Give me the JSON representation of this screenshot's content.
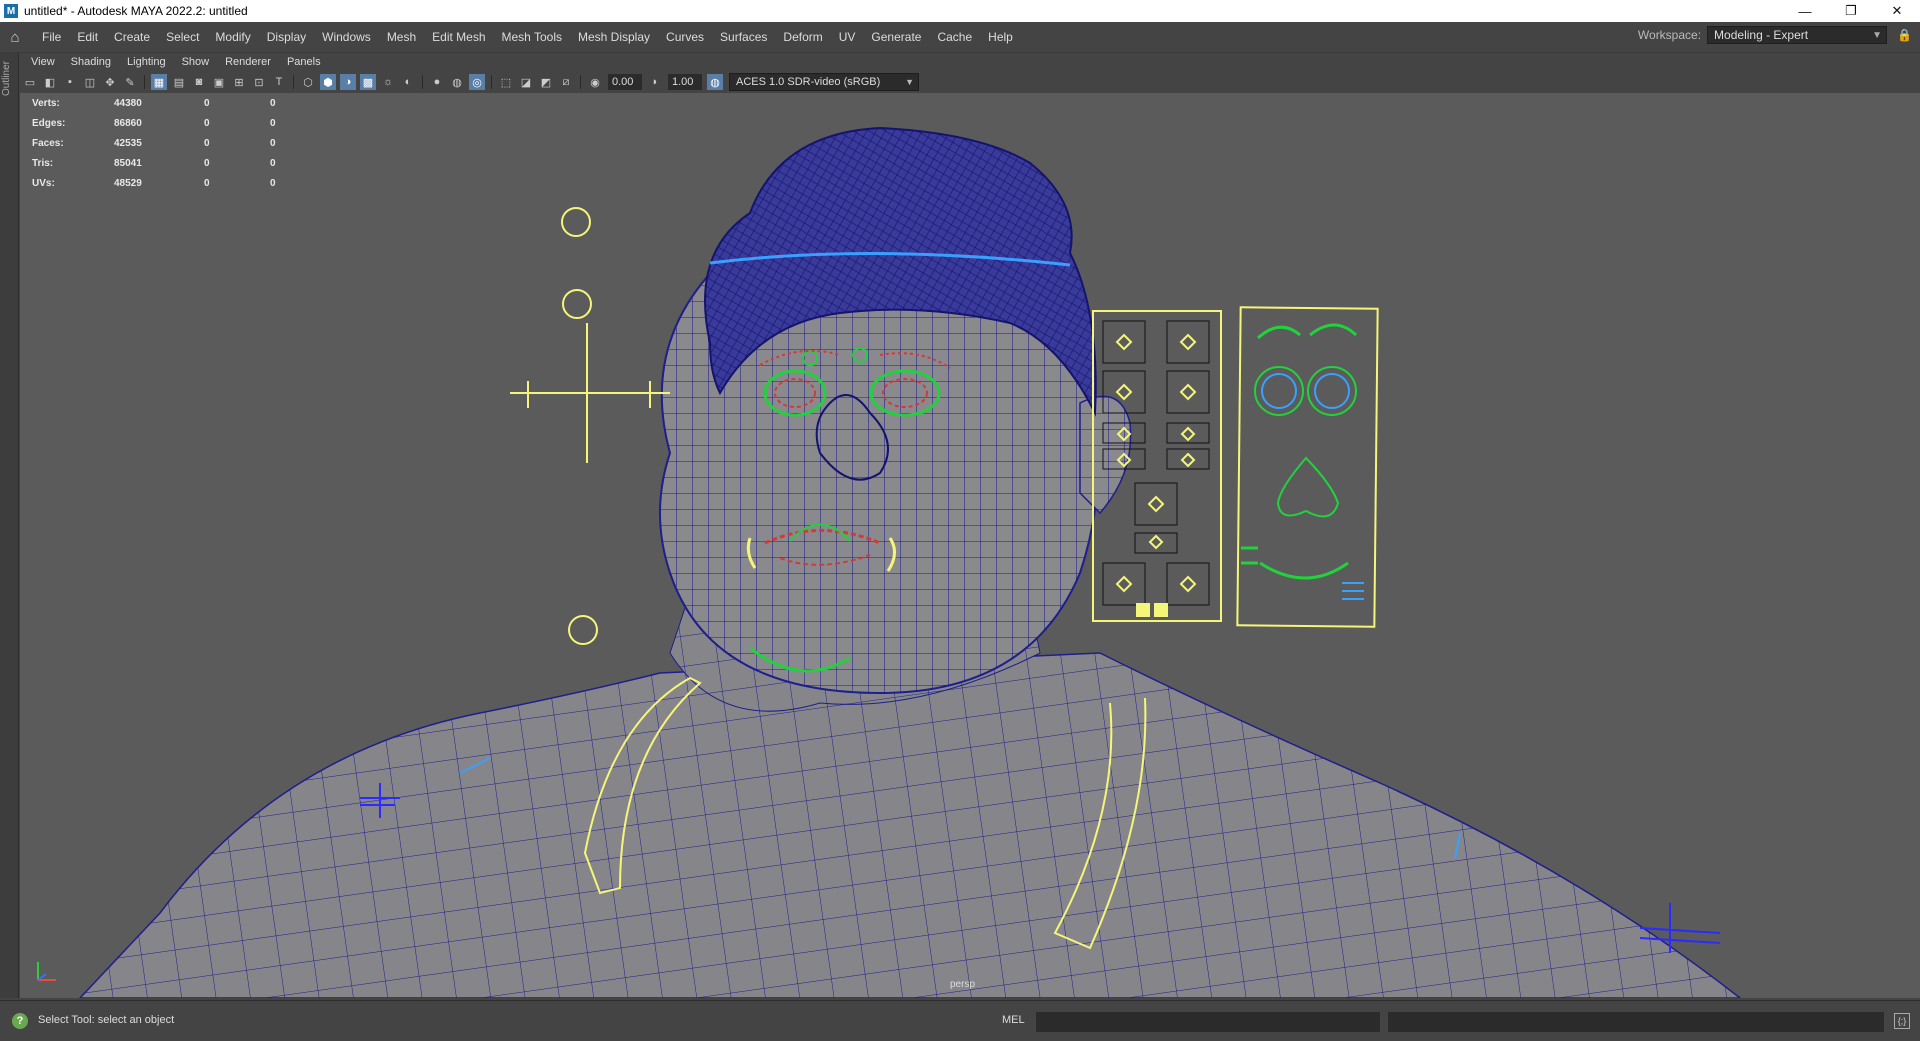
{
  "window": {
    "title": "untitled* - Autodesk MAYA 2022.2: untitled",
    "app_icon": "M",
    "controls": {
      "minimize": "—",
      "restore": "❐",
      "close": "✕"
    }
  },
  "menubar": {
    "home_icon": "⌂",
    "items": [
      "File",
      "Edit",
      "Create",
      "Select",
      "Modify",
      "Display",
      "Windows",
      "Mesh",
      "Edit Mesh",
      "Mesh Tools",
      "Mesh Display",
      "Curves",
      "Surfaces",
      "Deform",
      "UV",
      "Generate",
      "Cache",
      "Help"
    ],
    "workspace_label": "Workspace:",
    "workspace_value": "Modeling - Expert",
    "lock_icon": "🔒"
  },
  "outliner_label": "Outliner",
  "panel_menu": [
    "View",
    "Shading",
    "Lighting",
    "Show",
    "Renderer",
    "Panels"
  ],
  "toolbar": {
    "exposure": "0.00",
    "gamma": "1.00",
    "color_space": "ACES 1.0 SDR-video (sRGB)"
  },
  "hud": {
    "rows": [
      {
        "label": "Verts:",
        "value": "44380",
        "a": "0",
        "b": "0"
      },
      {
        "label": "Edges:",
        "value": "86860",
        "a": "0",
        "b": "0"
      },
      {
        "label": "Faces:",
        "value": "42535",
        "a": "0",
        "b": "0"
      },
      {
        "label": "Tris:",
        "value": "85041",
        "a": "0",
        "b": "0"
      },
      {
        "label": "UVs:",
        "value": "48529",
        "a": "0",
        "b": "0"
      }
    ]
  },
  "viewport": {
    "camera": "persp",
    "colors": {
      "wire": "#1e1e8c",
      "ctrl_yellow": "#f5f57a",
      "ctrl_green": "#22d23c",
      "ctrl_blue": "#3aa0ff",
      "ctrl_red": "#d23a3a"
    }
  },
  "status": {
    "help_icon": "?",
    "message": "Select Tool: select an object",
    "mel_label": "MEL"
  }
}
